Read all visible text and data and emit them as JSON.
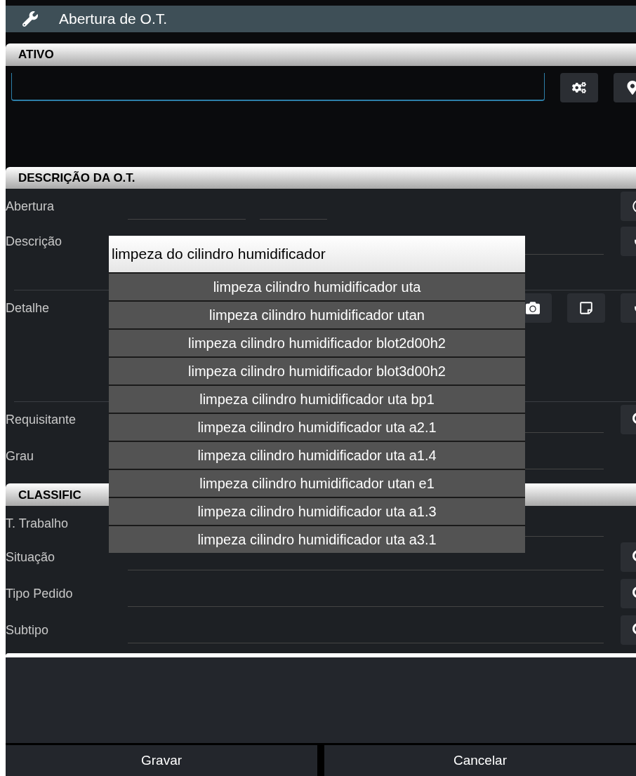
{
  "window": {
    "title": "Abertura de O.T."
  },
  "ativo": {
    "header": "ATIVO"
  },
  "descricao": {
    "header": "DESCRIÇÃO DA O.T.",
    "rows": [
      {
        "label": "Abertura",
        "kind": "datetime"
      },
      {
        "label": "Descrição",
        "kind": "mic"
      },
      {
        "label": "Detalhe",
        "kind": "media"
      },
      {
        "label": "Requisitante",
        "kind": "search"
      },
      {
        "label": "Grau",
        "kind": "plain"
      }
    ]
  },
  "classificacao": {
    "header": "CLASSIFIC",
    "rows": [
      {
        "label": "T. Trabalho",
        "kind": "plain"
      },
      {
        "label": "Situação",
        "kind": "search"
      },
      {
        "label": "Tipo Pedido",
        "kind": "search"
      },
      {
        "label": "Subtipo",
        "kind": "search"
      }
    ]
  },
  "autocomplete": {
    "value": "limpeza do cilindro humidificador",
    "suggestions": [
      "limpeza cilindro humidificador uta",
      "limpeza cilindro humidificador utan",
      "limpeza cilindro humidificador blot2d00h2",
      "limpeza cilindro humidificador blot3d00h2",
      "limpeza cilindro humidificador uta bp1",
      "limpeza cilindro humidificador uta a2.1",
      "limpeza cilindro humidificador uta a1.4",
      "limpeza cilindro humidificador utan e1",
      "limpeza cilindro humidificador uta a1.3",
      "limpeza cilindro humidificador uta a3.1"
    ]
  },
  "buttons": [
    "Gravar",
    "Cancelar"
  ]
}
